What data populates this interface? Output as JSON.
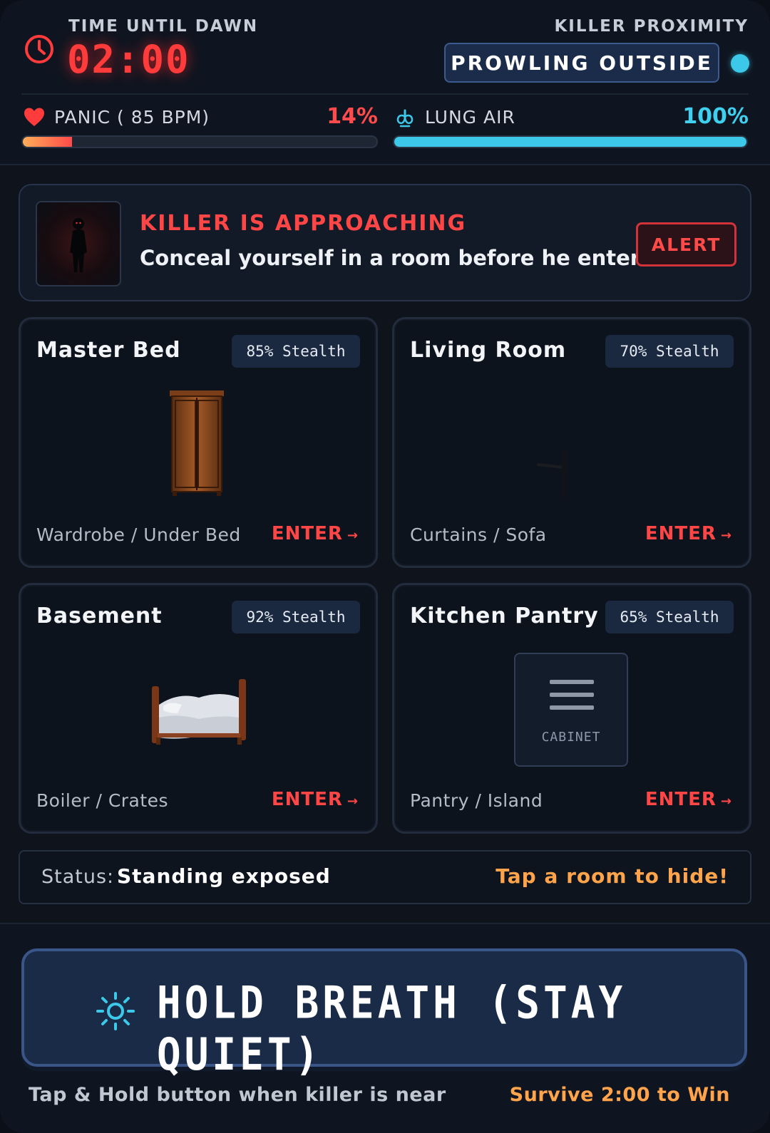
{
  "hud": {
    "dawn_label": "TIME UNTIL DAWN",
    "timer": "02:00",
    "proximity_label": "KILLER PROXIMITY",
    "proximity_status": "PROWLING OUTSIDE",
    "panic_label": "PANIC ( 85 BPM)",
    "panic_percent": "14%",
    "panic_level": 0.14,
    "lung_label": "LUNG AIR",
    "lung_percent": "100%",
    "lung_level": 1.0
  },
  "alert": {
    "title": "KILLER IS APPROACHING",
    "message": "Conceal yourself in a room before he enters!",
    "button": "ALERT"
  },
  "rooms": [
    {
      "name": "Master Bed",
      "stealth": "85% Stealth",
      "spots": "Wardrobe / Under Bed",
      "enter": "ENTER",
      "art": "wardrobe"
    },
    {
      "name": "Living Room",
      "stealth": "70% Stealth",
      "spots": "Curtains / Sofa",
      "enter": "ENTER",
      "art": "curtain-rod"
    },
    {
      "name": "Basement",
      "stealth": "92% Stealth",
      "spots": "Boiler / Crates",
      "enter": "ENTER",
      "art": "bed"
    },
    {
      "name": "Kitchen Pantry",
      "stealth": "65% Stealth",
      "spots": "Pantry / Island",
      "enter": "ENTER",
      "art": "cabinet",
      "art_label": "CABINET"
    }
  ],
  "status": {
    "key": "Status:",
    "value": "Standing exposed",
    "hint": "Tap a room to hide!"
  },
  "footer": {
    "button": "HOLD BREATH (STAY QUIET)",
    "hint_left": "Tap & Hold button when killer is near",
    "hint_right": "Survive 2:00 to Win"
  },
  "colors": {
    "danger": "#ff4646",
    "accent_cyan": "#3cc8e8",
    "warning_orange": "#ffa44a",
    "panel_blue": "#1a2b48"
  }
}
